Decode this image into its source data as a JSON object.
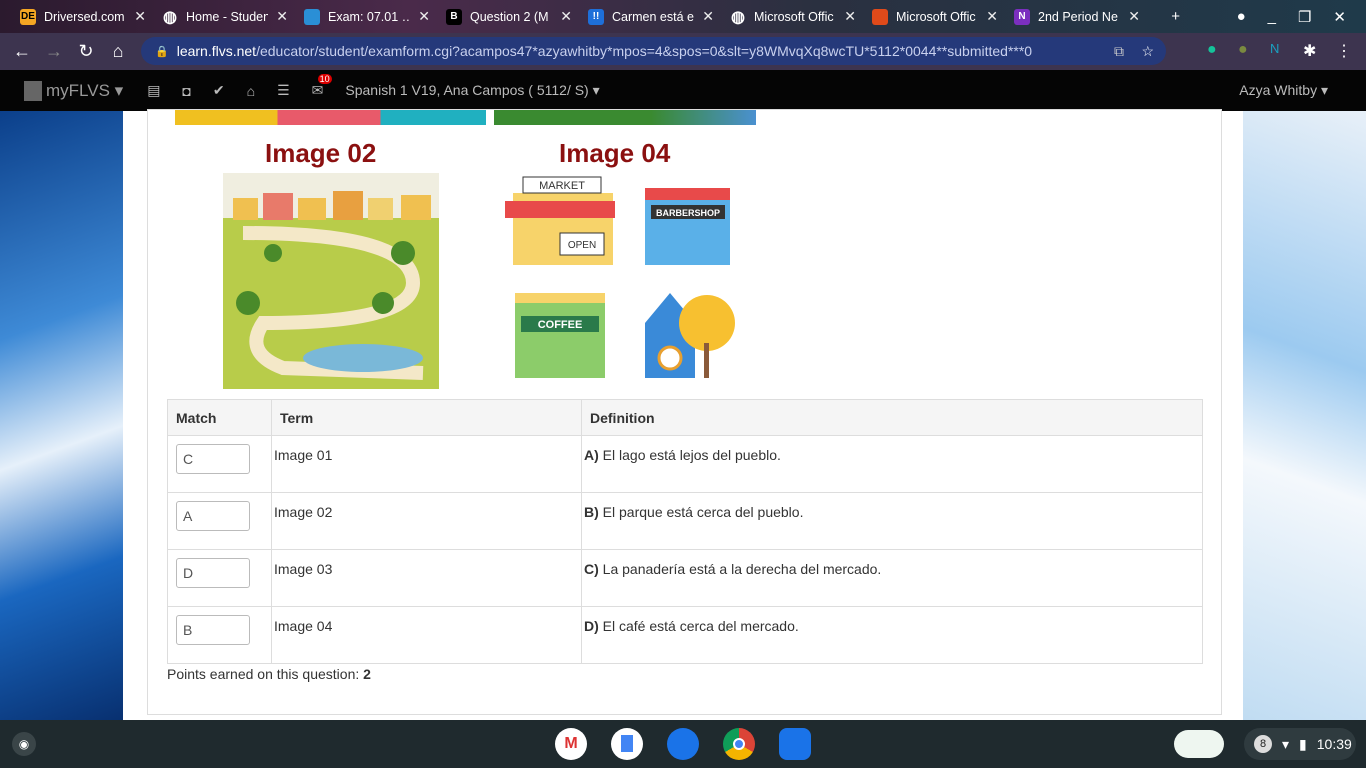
{
  "tabs": [
    {
      "title": "Driversed.com",
      "icon": "DE",
      "color": "#f5a623"
    },
    {
      "title": "Home - Studen",
      "icon": "globe",
      "color": "#fff"
    },
    {
      "title": "Exam: 07.01 …",
      "icon": "flvs",
      "color": "#2a8fd6"
    },
    {
      "title": "Question 2 (M",
      "icon": "B",
      "color": "#000"
    },
    {
      "title": "Carmen está e…",
      "icon": "!!",
      "color": "#1e6fd9"
    },
    {
      "title": "Microsoft Offic",
      "icon": "globe",
      "color": "#fff"
    },
    {
      "title": "Microsoft Offic",
      "icon": "office",
      "color": "#e04a1a"
    },
    {
      "title": "2nd Period Ne",
      "icon": "N",
      "color": "#7b2fbf"
    }
  ],
  "address": {
    "domain": "learn.flvs.net",
    "path": "/educator/student/examform.cgi?acampos47*azyawhitby*mpos=4&spos=0&slt=y8WMvqXq8wcTU*5112*0044**submitted***0"
  },
  "nav": {
    "brand": "myFLVS",
    "badge": "10",
    "course": "Spanish 1 V19, Ana Campos ( 5112/ S)",
    "user": "Azya Whitby"
  },
  "images": {
    "image02_title": "Image 02",
    "image04_title": "Image 04",
    "market": "MARKET",
    "open": "OPEN",
    "barbershop": "BARBERSHOP",
    "coffee": "COFFEE"
  },
  "table": {
    "headers": [
      "Match",
      "Term",
      "Definition"
    ],
    "rows": [
      {
        "match": "C",
        "term": "Image 01",
        "letter": "A)",
        "definition": "El lago está lejos del pueblo."
      },
      {
        "match": "A",
        "term": "Image 02",
        "letter": "B)",
        "definition": "El parque está cerca del pueblo."
      },
      {
        "match": "D",
        "term": "Image 03",
        "letter": "C)",
        "definition": "La panadería está a la derecha del mercado."
      },
      {
        "match": "B",
        "term": "Image 04",
        "letter": "D)",
        "definition": "El café está cerca del mercado."
      }
    ]
  },
  "points": {
    "label": "Points earned on this question:",
    "value": "2"
  },
  "tray": {
    "notifications": "8",
    "time": "10:39"
  }
}
